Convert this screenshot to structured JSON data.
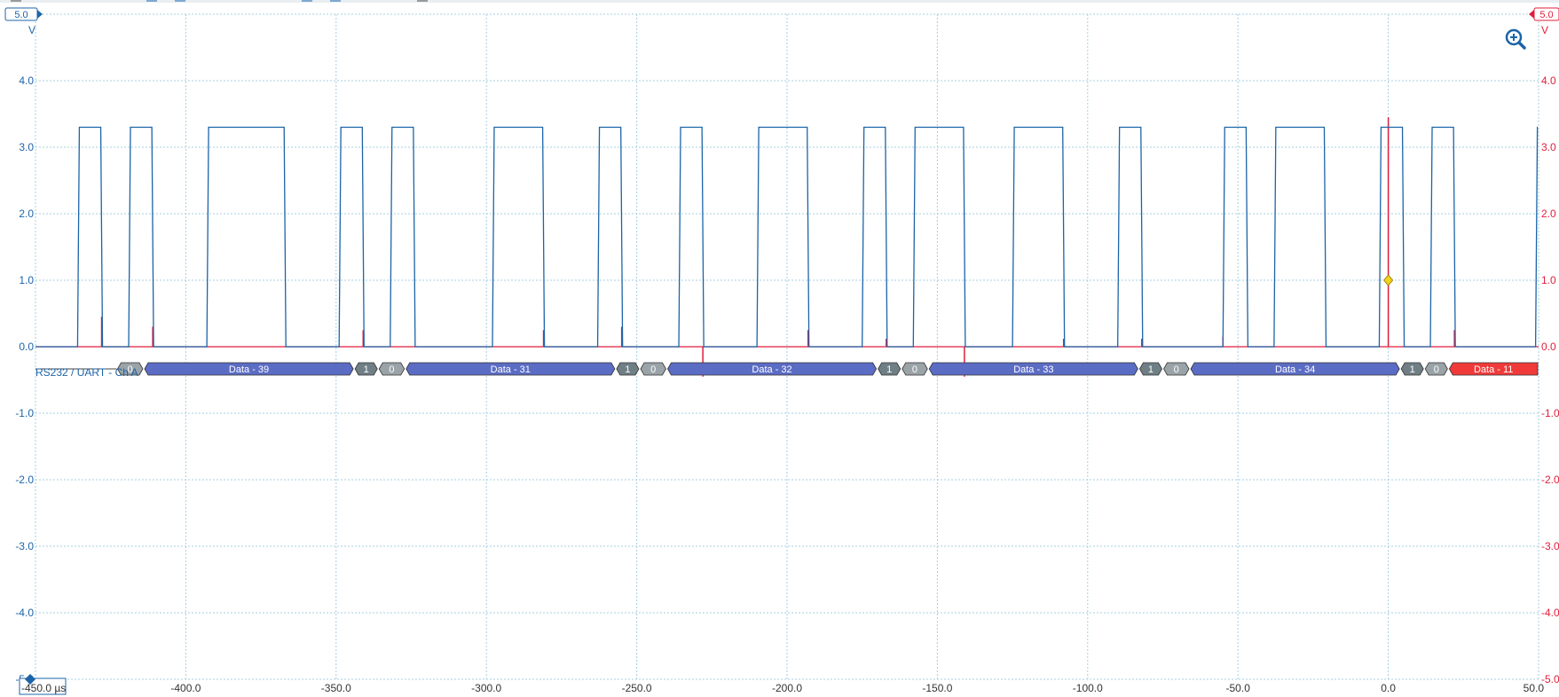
{
  "toolbar": {
    "zoom_icon": "zoom-in-icon"
  },
  "colors": {
    "channel_a": "#1c64a8",
    "channel_b": "#e01e3c",
    "grid": "#a6cfe0",
    "decode_data": "#5b6cc4",
    "decode_bit": "#6f7f85",
    "decode_start": "#9aa3a8",
    "decode_error": "#f03a3a",
    "trigger": "#f2d21b"
  },
  "decoder": {
    "label": "RS232 / UART - Ch A",
    "segments": [
      {
        "type": "start",
        "label": "0",
        "t0": -423,
        "t1": -414
      },
      {
        "type": "data",
        "label": "Data - 39",
        "t0": -414,
        "t1": -344
      },
      {
        "type": "stop",
        "label": "1",
        "t0": -344,
        "t1": -336
      },
      {
        "type": "start",
        "label": "0",
        "t0": -336,
        "t1": -327
      },
      {
        "type": "data",
        "label": "Data - 31",
        "t0": -327,
        "t1": -257
      },
      {
        "type": "stop",
        "label": "1",
        "t0": -257,
        "t1": -249
      },
      {
        "type": "start",
        "label": "0",
        "t0": -249,
        "t1": -240
      },
      {
        "type": "data",
        "label": "Data - 32",
        "t0": -240,
        "t1": -170
      },
      {
        "type": "stop",
        "label": "1",
        "t0": -170,
        "t1": -162
      },
      {
        "type": "start",
        "label": "0",
        "t0": -162,
        "t1": -153
      },
      {
        "type": "data",
        "label": "Data - 33",
        "t0": -153,
        "t1": -83
      },
      {
        "type": "stop",
        "label": "1",
        "t0": -83,
        "t1": -75
      },
      {
        "type": "start",
        "label": "0",
        "t0": -75,
        "t1": -66
      },
      {
        "type": "data",
        "label": "Data - 34",
        "t0": -66,
        "t1": 4
      },
      {
        "type": "stop",
        "label": "1",
        "t0": 4,
        "t1": 12
      },
      {
        "type": "start",
        "label": "0",
        "t0": 12,
        "t1": 20
      },
      {
        "type": "error",
        "label": "Data - 11",
        "t0": 20,
        "t1": 50
      }
    ]
  },
  "chart_data": {
    "type": "line",
    "title": "",
    "xlabel": "",
    "x_unit": "µs",
    "x_range_label": "-450.0 µs",
    "xlim": [
      -450,
      50
    ],
    "x_ticks": [
      -450,
      -400,
      -350,
      -300,
      -250,
      -200,
      -150,
      -100,
      -50,
      0,
      50
    ],
    "x_tick_labels": [
      "-450.0",
      "-400.0",
      "-350.0",
      "-300.0",
      "-250.0",
      "-200.0",
      "-150.0",
      "-100.0",
      "-50.0",
      "0.0",
      "50.0"
    ],
    "y_left": {
      "unit": "V",
      "range_label": "5.0",
      "ylim": [
        -5,
        5
      ],
      "ticks": [
        4,
        3,
        2,
        1,
        0,
        -1,
        -2,
        -3,
        -4,
        -5
      ],
      "tick_labels": [
        "4.0",
        "3.0",
        "2.0",
        "1.0",
        "0.0",
        "-1.0",
        "-2.0",
        "-3.0",
        "-4.0",
        "-5.0"
      ]
    },
    "y_right": {
      "unit": "V",
      "range_label": "5.0",
      "ylim": [
        -5,
        5
      ],
      "ticks": [
        4,
        3,
        2,
        1,
        0,
        -1,
        -2,
        -3,
        -4,
        -5
      ],
      "tick_labels": [
        "4.0",
        "3.0",
        "2.0",
        "1.0",
        "0.0",
        "-1.0",
        "-2.0",
        "-3.0",
        "-4.0",
        "-5.0"
      ]
    },
    "grid": true,
    "trigger": {
      "t": 0,
      "v": 1.0
    },
    "series": [
      {
        "high_level": 3.3,
        "low_level": 0.0,
        "high_pulses": [
          [
            -436,
            -428
          ],
          [
            -419,
            -411
          ],
          [
            -393,
            -367
          ],
          [
            -349,
            -341
          ],
          [
            -332,
            -324
          ],
          [
            -298,
            -281
          ],
          [
            -263,
            -255
          ],
          [
            -236,
            -228
          ],
          [
            -210,
            -193
          ],
          [
            -175,
            -167
          ],
          [
            -158,
            -141
          ],
          [
            -125,
            -108
          ],
          [
            -90,
            -82
          ],
          [
            -55,
            -47
          ],
          [
            -38,
            -21
          ],
          [
            -3,
            5
          ],
          [
            14,
            22
          ],
          [
            49,
            50
          ]
        ]
      },
      {
        "baseline": 0.0,
        "spikes": [
          [
            -428,
            0.45
          ],
          [
            -411,
            0.3
          ],
          [
            -341,
            0.25
          ],
          [
            -281,
            0.25
          ],
          [
            -255,
            0.3
          ],
          [
            -228,
            -0.45
          ],
          [
            -193,
            0.25
          ],
          [
            -167,
            0.12
          ],
          [
            -141,
            -0.45
          ],
          [
            -108,
            0.12
          ],
          [
            -82,
            0.12
          ],
          [
            -55,
            0.15
          ],
          [
            0,
            3.45
          ],
          [
            22,
            0.25
          ]
        ]
      }
    ]
  }
}
